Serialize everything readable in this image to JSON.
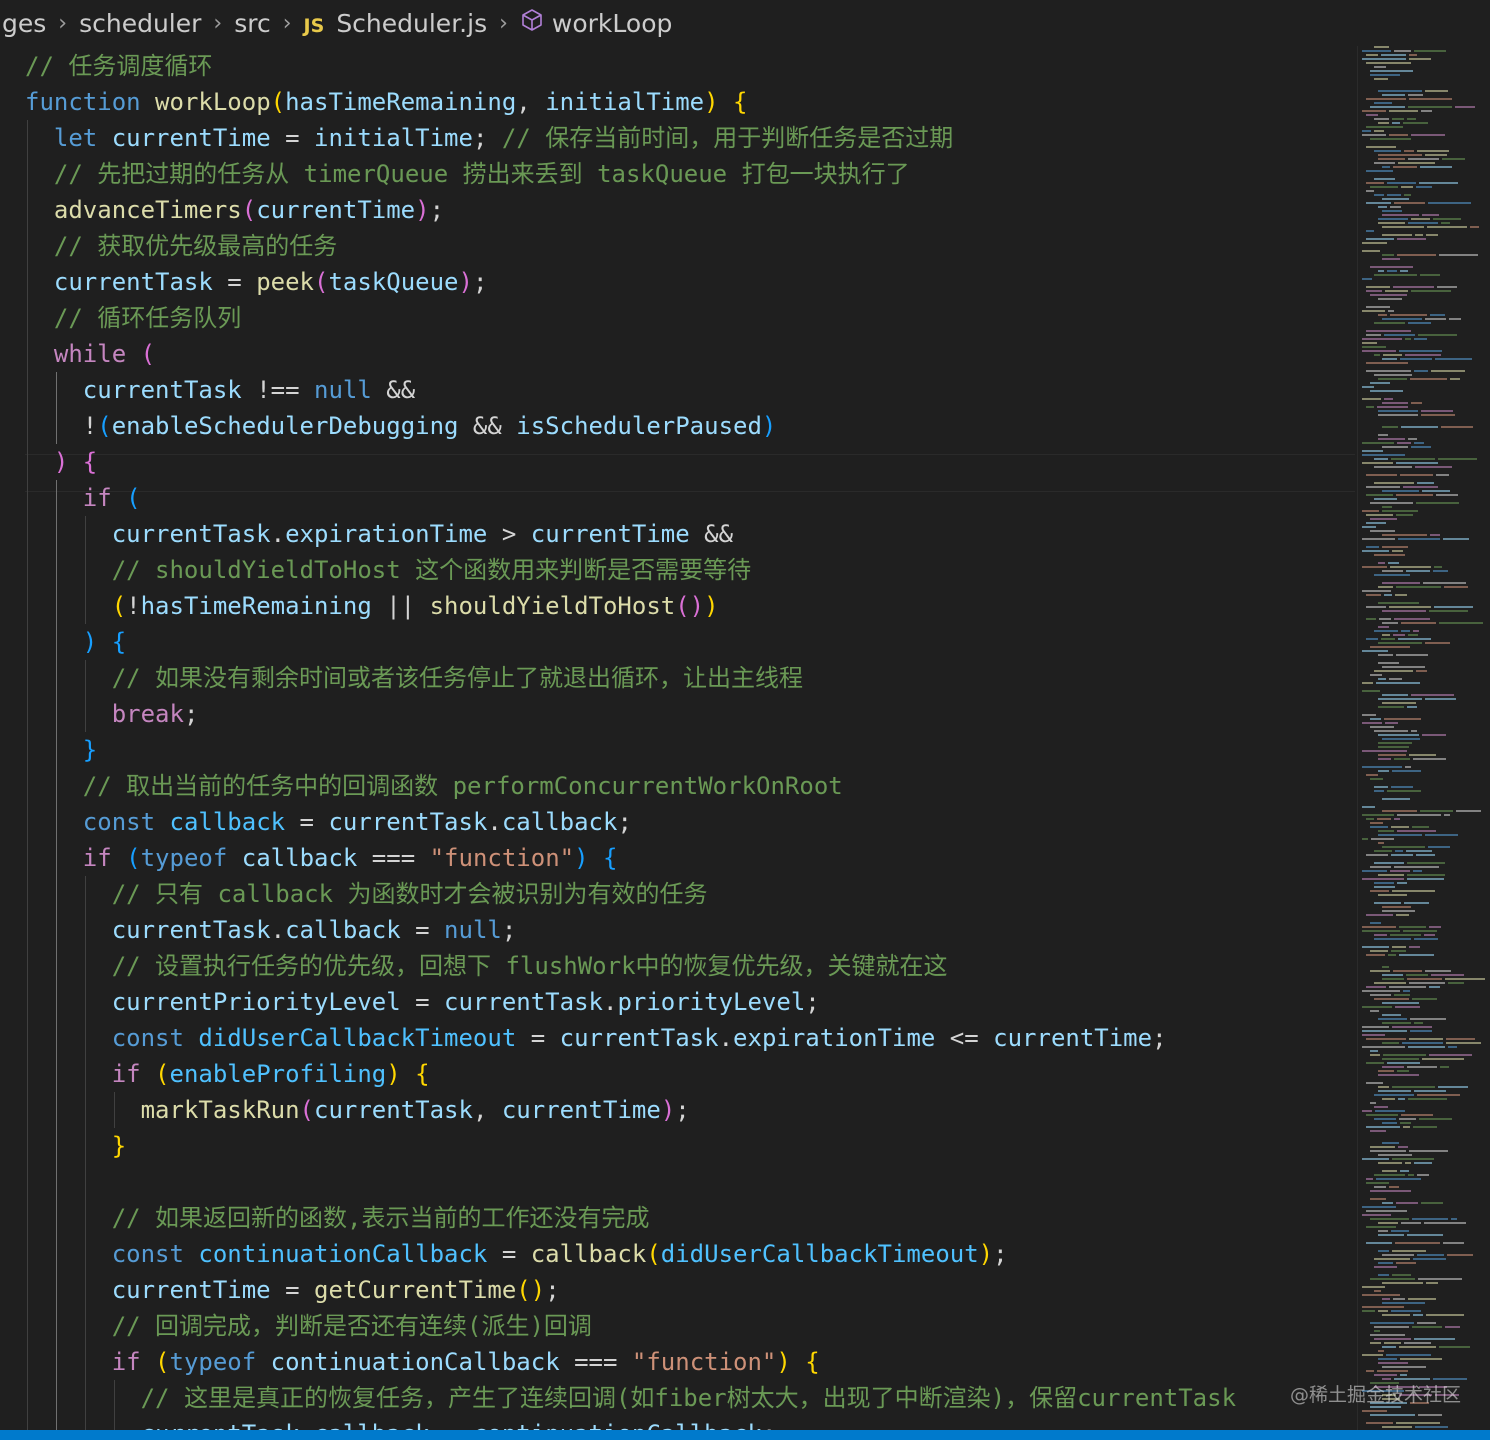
{
  "breadcrumb": {
    "items": [
      {
        "label": "ges",
        "icon": null
      },
      {
        "label": "scheduler",
        "icon": null
      },
      {
        "label": "src",
        "icon": null
      },
      {
        "label": "Scheduler.js",
        "icon": "js-file-icon"
      },
      {
        "label": "workLoop",
        "icon": "method-cube-icon"
      }
    ],
    "js_badge": "JS"
  },
  "editor": {
    "language": "javascript",
    "colors": {
      "background": "#1f1f1f",
      "comment": "#6a9955",
      "keyword": "#569cd6",
      "control": "#c586c0",
      "function": "#dcdcaa",
      "variable": "#9cdcfe",
      "string": "#ce9178"
    },
    "lines": [
      {
        "indent": 0,
        "tokens": [
          [
            "c",
            "// 任务调度循环"
          ]
        ]
      },
      {
        "indent": 0,
        "tokens": [
          [
            "k",
            "function"
          ],
          [
            "p",
            " "
          ],
          [
            "f",
            "workLoop"
          ],
          [
            "y",
            "("
          ],
          [
            "v",
            "hasTimeRemaining"
          ],
          [
            "p",
            ", "
          ],
          [
            "v",
            "initialTime"
          ],
          [
            "y",
            ")"
          ],
          [
            "p",
            " "
          ],
          [
            "y",
            "{"
          ]
        ]
      },
      {
        "indent": 1,
        "tokens": [
          [
            "k",
            "let"
          ],
          [
            "p",
            " "
          ],
          [
            "v",
            "currentTime"
          ],
          [
            "p",
            " = "
          ],
          [
            "v",
            "initialTime"
          ],
          [
            "p",
            "; "
          ],
          [
            "c",
            "// 保存当前时间，用于判断任务是否过期"
          ]
        ]
      },
      {
        "indent": 1,
        "tokens": [
          [
            "c",
            "// 先把过期的任务从 timerQueue 捞出来丢到 taskQueue 打包一块执行了"
          ]
        ]
      },
      {
        "indent": 1,
        "tokens": [
          [
            "f",
            "advanceTimers"
          ],
          [
            "m",
            "("
          ],
          [
            "v",
            "currentTime"
          ],
          [
            "m",
            ")"
          ],
          [
            "p",
            ";"
          ]
        ]
      },
      {
        "indent": 1,
        "tokens": [
          [
            "c",
            "// 获取优先级最高的任务"
          ]
        ]
      },
      {
        "indent": 1,
        "tokens": [
          [
            "v",
            "currentTask"
          ],
          [
            "p",
            " = "
          ],
          [
            "f",
            "peek"
          ],
          [
            "m",
            "("
          ],
          [
            "v",
            "taskQueue"
          ],
          [
            "m",
            ")"
          ],
          [
            "p",
            ";"
          ]
        ]
      },
      {
        "indent": 1,
        "tokens": [
          [
            "c",
            "// 循环任务队列"
          ]
        ]
      },
      {
        "indent": 1,
        "tokens": [
          [
            "x",
            "while"
          ],
          [
            "p",
            " "
          ],
          [
            "m",
            "("
          ]
        ]
      },
      {
        "indent": 2,
        "tokens": [
          [
            "v",
            "currentTask"
          ],
          [
            "p",
            " !== "
          ],
          [
            "k",
            "null"
          ],
          [
            "p",
            " &&"
          ]
        ]
      },
      {
        "indent": 2,
        "tokens": [
          [
            "p",
            "!"
          ],
          [
            "b",
            "("
          ],
          [
            "v",
            "enableSchedulerDebugging"
          ],
          [
            "p",
            " && "
          ],
          [
            "v",
            "isSchedulerPaused"
          ],
          [
            "b",
            ")"
          ]
        ]
      },
      {
        "indent": 1,
        "tokens": [
          [
            "m",
            ")"
          ],
          [
            "p",
            " "
          ],
          [
            "m",
            "{"
          ]
        ]
      },
      {
        "indent": 2,
        "tokens": [
          [
            "x",
            "if"
          ],
          [
            "p",
            " "
          ],
          [
            "b",
            "("
          ]
        ]
      },
      {
        "indent": 3,
        "tokens": [
          [
            "v",
            "currentTask"
          ],
          [
            "p",
            "."
          ],
          [
            "v",
            "expirationTime"
          ],
          [
            "p",
            " > "
          ],
          [
            "v",
            "currentTime"
          ],
          [
            "p",
            " &&"
          ]
        ]
      },
      {
        "indent": 3,
        "tokens": [
          [
            "c",
            "// shouldYieldToHost 这个函数用来判断是否需要等待"
          ]
        ]
      },
      {
        "indent": 3,
        "tokens": [
          [
            "y",
            "("
          ],
          [
            "p",
            "!"
          ],
          [
            "v",
            "hasTimeRemaining"
          ],
          [
            "p",
            " || "
          ],
          [
            "f",
            "shouldYieldToHost"
          ],
          [
            "m",
            "()"
          ],
          [
            "y",
            ")"
          ]
        ]
      },
      {
        "indent": 2,
        "tokens": [
          [
            "b",
            ")"
          ],
          [
            "p",
            " "
          ],
          [
            "b",
            "{"
          ]
        ]
      },
      {
        "indent": 3,
        "tokens": [
          [
            "c",
            "// 如果没有剩余时间或者该任务停止了就退出循环，让出主线程"
          ]
        ]
      },
      {
        "indent": 3,
        "tokens": [
          [
            "x",
            "break"
          ],
          [
            "p",
            ";"
          ]
        ]
      },
      {
        "indent": 2,
        "tokens": [
          [
            "b",
            "}"
          ]
        ]
      },
      {
        "indent": 2,
        "tokens": [
          [
            "c",
            "// 取出当前的任务中的回调函数 performConcurrentWorkOnRoot"
          ]
        ]
      },
      {
        "indent": 2,
        "tokens": [
          [
            "k",
            "const"
          ],
          [
            "p",
            " "
          ],
          [
            "n",
            "callback"
          ],
          [
            "p",
            " = "
          ],
          [
            "v",
            "currentTask"
          ],
          [
            "p",
            "."
          ],
          [
            "v",
            "callback"
          ],
          [
            "p",
            ";"
          ]
        ]
      },
      {
        "indent": 2,
        "tokens": [
          [
            "x",
            "if"
          ],
          [
            "p",
            " "
          ],
          [
            "b",
            "("
          ],
          [
            "k",
            "typeof"
          ],
          [
            "p",
            " "
          ],
          [
            "v",
            "callback"
          ],
          [
            "p",
            " === "
          ],
          [
            "s",
            "\"function\""
          ],
          [
            "b",
            ")"
          ],
          [
            "p",
            " "
          ],
          [
            "b",
            "{"
          ]
        ]
      },
      {
        "indent": 3,
        "tokens": [
          [
            "c",
            "// 只有 callback 为函数时才会被识别为有效的任务"
          ]
        ]
      },
      {
        "indent": 3,
        "tokens": [
          [
            "v",
            "currentTask"
          ],
          [
            "p",
            "."
          ],
          [
            "v",
            "callback"
          ],
          [
            "p",
            " = "
          ],
          [
            "k",
            "null"
          ],
          [
            "p",
            ";"
          ]
        ]
      },
      {
        "indent": 3,
        "tokens": [
          [
            "c",
            "// 设置执行任务的优先级，回想下 flushWork中的恢复优先级，关键就在这"
          ]
        ]
      },
      {
        "indent": 3,
        "tokens": [
          [
            "v",
            "currentPriorityLevel"
          ],
          [
            "p",
            " = "
          ],
          [
            "v",
            "currentTask"
          ],
          [
            "p",
            "."
          ],
          [
            "v",
            "priorityLevel"
          ],
          [
            "p",
            ";"
          ]
        ]
      },
      {
        "indent": 3,
        "tokens": [
          [
            "k",
            "const"
          ],
          [
            "p",
            " "
          ],
          [
            "n",
            "didUserCallbackTimeout"
          ],
          [
            "p",
            " = "
          ],
          [
            "v",
            "currentTask"
          ],
          [
            "p",
            "."
          ],
          [
            "v",
            "expirationTime"
          ],
          [
            "p",
            " <= "
          ],
          [
            "v",
            "currentTime"
          ],
          [
            "p",
            ";"
          ]
        ]
      },
      {
        "indent": 3,
        "tokens": [
          [
            "x",
            "if"
          ],
          [
            "p",
            " "
          ],
          [
            "y",
            "("
          ],
          [
            "n",
            "enableProfiling"
          ],
          [
            "y",
            ")"
          ],
          [
            "p",
            " "
          ],
          [
            "y",
            "{"
          ]
        ]
      },
      {
        "indent": 4,
        "tokens": [
          [
            "f",
            "markTaskRun"
          ],
          [
            "m",
            "("
          ],
          [
            "v",
            "currentTask"
          ],
          [
            "p",
            ", "
          ],
          [
            "v",
            "currentTime"
          ],
          [
            "m",
            ")"
          ],
          [
            "p",
            ";"
          ]
        ]
      },
      {
        "indent": 3,
        "tokens": [
          [
            "y",
            "}"
          ]
        ]
      },
      {
        "indent": 3,
        "tokens": []
      },
      {
        "indent": 3,
        "tokens": [
          [
            "c",
            "// 如果返回新的函数,表示当前的工作还没有完成"
          ]
        ]
      },
      {
        "indent": 3,
        "tokens": [
          [
            "k",
            "const"
          ],
          [
            "p",
            " "
          ],
          [
            "n",
            "continuationCallback"
          ],
          [
            "p",
            " = "
          ],
          [
            "f",
            "callback"
          ],
          [
            "y",
            "("
          ],
          [
            "n",
            "didUserCallbackTimeout"
          ],
          [
            "y",
            ")"
          ],
          [
            "p",
            ";"
          ]
        ]
      },
      {
        "indent": 3,
        "tokens": [
          [
            "v",
            "currentTime"
          ],
          [
            "p",
            " = "
          ],
          [
            "f",
            "getCurrentTime"
          ],
          [
            "y",
            "()"
          ],
          [
            "p",
            ";"
          ]
        ]
      },
      {
        "indent": 3,
        "tokens": [
          [
            "c",
            "// 回调完成，判断是否还有连续(派生)回调"
          ]
        ]
      },
      {
        "indent": 3,
        "tokens": [
          [
            "x",
            "if"
          ],
          [
            "p",
            " "
          ],
          [
            "y",
            "("
          ],
          [
            "k",
            "typeof"
          ],
          [
            "p",
            " "
          ],
          [
            "v",
            "continuationCallback"
          ],
          [
            "p",
            " === "
          ],
          [
            "s",
            "\"function\""
          ],
          [
            "y",
            ")"
          ],
          [
            "p",
            " "
          ],
          [
            "y",
            "{"
          ]
        ]
      },
      {
        "indent": 4,
        "tokens": [
          [
            "c",
            "// 这里是真正的恢复任务，产生了连续回调(如fiber树太大，出现了中断渲染)，保留currentTask"
          ]
        ]
      },
      {
        "indent": 4,
        "tokens": [
          [
            "v",
            "currentTask"
          ],
          [
            "p",
            "."
          ],
          [
            "v",
            "callback"
          ],
          [
            "p",
            " = "
          ],
          [
            "v",
            "continuationCallback"
          ],
          [
            "p",
            ";"
          ]
        ]
      }
    ]
  },
  "watermark": "@稀土掘金技术社区"
}
